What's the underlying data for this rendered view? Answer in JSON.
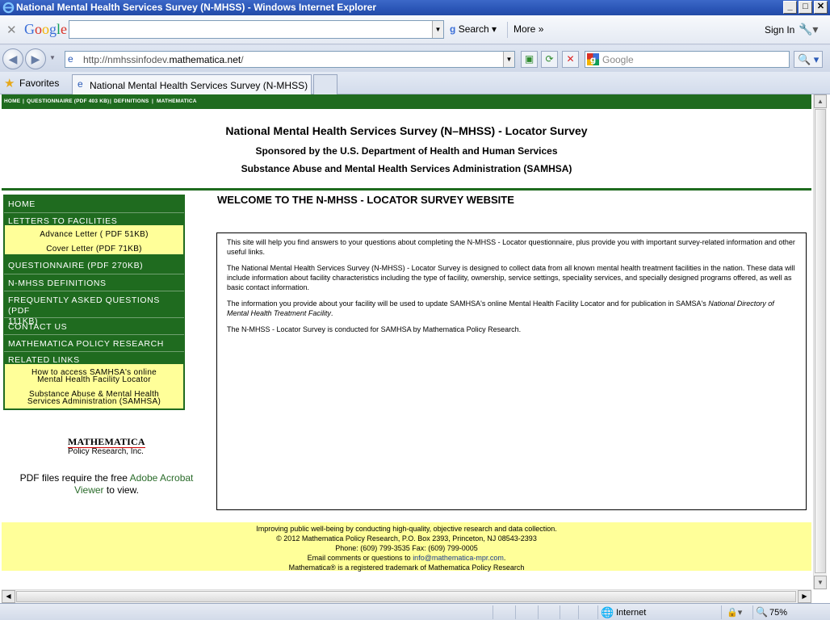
{
  "window": {
    "title": "National Mental Health Services Survey (N-MHSS) - Windows Internet Explorer",
    "controls": {
      "minimize": "_",
      "maximize": "□",
      "close": "✕"
    }
  },
  "google_toolbar": {
    "close_glyph": "✕",
    "logo": "Google",
    "search_label": "Search",
    "more_label": "More",
    "more_glyph": "»",
    "signin_label": "Sign In"
  },
  "address_bar": {
    "url_prefix": "http://nmhssinfodev.",
    "url_domain": "mathematica.net",
    "url_suffix": "/",
    "search_placeholder": "Google"
  },
  "favorites_bar": {
    "favorites_label": "Favorites",
    "tab_title": "National Mental Health Services Survey (N-MHSS)"
  },
  "page": {
    "topnav": [
      "HOME",
      "|",
      "QUESTIONNAIRE (PDF 403 KB)",
      "|",
      "DEFINITIONS",
      "|",
      "MATHEMATICA"
    ],
    "header": {
      "title": "National Mental Health Services Survey (N–MHSS) - Locator Survey",
      "sponsor": "Sponsored by the U.S. Department of Health and Human Services",
      "agency": "Substance Abuse and Mental Health Services Administration (SAMHSA)"
    },
    "sidenav": {
      "home": "HOME",
      "letters": "LETTERS TO FACILITIES",
      "advance_letter": "Advance Letter ( PDF 51KB)",
      "cover_letter": "Cover Letter (PDF 71KB)",
      "questionnaire": "QUESTIONNAIRE (PDF 270KB)",
      "definitions": "N-MHSS DEFINITIONS",
      "faq_line1": "FREQUENTLY ASKED QUESTIONS (PDF",
      "faq_line2": "111KB)",
      "contact": "CONTACT US",
      "policy_research": "MATHEMATICA POLICY RESEARCH",
      "related": "RELATED LINKS",
      "samhsa_locator_line1": "How to access SAMHSA's online",
      "samhsa_locator_line2": "Mental Health Facility Locator",
      "samhsa_line1": "Substance Abuse & Mental Health",
      "samhsa_line2": "Services Administration (SAMHSA)"
    },
    "logo": {
      "name": "MATHEMATICA",
      "sub": "Policy Research, Inc."
    },
    "pdf_note": {
      "before": "PDF files require the free ",
      "link": "Adobe Acrobat Viewer",
      "after": " to view."
    },
    "welcome": "WELCOME TO THE N-MHSS - LOCATOR SURVEY WEBSITE",
    "paragraphs": {
      "p1": "This site will help you find answers to your questions about completing the N-MHSS - Locator questionnaire, plus provide you with important survey-related information and other useful links.",
      "p2": "The National Mental Health Services Survey (N-MHSS) - Locator Survey is designed to collect data from all known mental health treatment facilities in the nation. These data will include information about facility characteristics including the type of facility, ownership, service settings, speciality services, and specially designed programs offered, as well as basic contact information.",
      "p3_before": "The information you provide about your facility will be used to update SAMHSA's online Mental Health Facility Locator and for publication in SAMSA's ",
      "p3_italic": "National Directory of Mental Health Treatment Facility",
      "p3_after": ".",
      "p4": "The N-MHSS - Locator Survey is conducted for SAMHSA by Mathematica Policy Research."
    },
    "footer": {
      "line1": "Improving public well-being by conducting high-quality, objective research and data collection.",
      "line2": "© 2012 Mathematica Policy Research, P.O. Box 2393, Princeton, NJ 08543-2393",
      "line3": "Phone: (609) 799-3535 Fax: (609) 799-0005",
      "line4_before": "Email comments or questions to ",
      "email": "info@mathematica-mpr.com",
      "line4_after": ".",
      "line5": "Mathematica® is a registered trademark of Mathematica Policy Research"
    }
  },
  "status_bar": {
    "zone": "Internet",
    "zoom": "75%"
  }
}
